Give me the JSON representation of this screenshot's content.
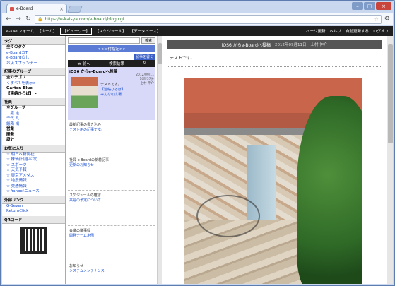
{
  "browser": {
    "tab_title": "e-Board",
    "url": "https://e-kaisya.com/e-board/blog.cgi"
  },
  "topnav": {
    "brand": "e-Kaelフォーム",
    "links": [
      "【ホーム】",
      "【ビューワー】",
      "【スケジュール】",
      "【データベース】"
    ],
    "right_links": [
      "ページ更新",
      "ヘルプ",
      "自動更新する",
      "ログオフ"
    ]
  },
  "sidebar": {
    "tags_title": "タグ",
    "all_tags": "全てのタグ",
    "tag_items": [
      "e-BoardカT",
      "e-Boardのし",
      "お店スプランナー"
    ],
    "group_title": "記事のグループ",
    "all_categories": "全カテゴリ",
    "group_items": [
      "くすべてを表示>",
      "Garten Blue -",
      "【連絡ひろば】 -"
    ],
    "company_title": "社員",
    "all_groups": "全グループ",
    "company_items": [
      "二瓶 進",
      "千代 凡",
      "総務 鳩",
      "営業",
      "開発",
      "設計"
    ],
    "fav_title": "お気に入り",
    "fav_items": [
      "☆ 朝日へ新聞社",
      "☆ 株価(日経平均)",
      "☆ スポーツ",
      "☆ 天気予報",
      "☆ 東京アメダス",
      "☆ 地震情報",
      "☆ 交通情報",
      "☆ Yahoo!ニュース"
    ],
    "ext_title": "外部リンク",
    "ext_items": [
      "G-Seven",
      "ReturnClick"
    ],
    "qr_title": "QRコード"
  },
  "middle": {
    "search_button": "検索",
    "date_bar": "<<日付指定>>",
    "new_post": "記事を書く",
    "prev": "≪ 前へ",
    "results": "検索結果",
    "selected_title": "iOS6 からe-Boardへ投稿",
    "selected_date": "2012/09/11",
    "selected_time": "10時57分",
    "selected_author": "上村 伸介",
    "selected_lines": [
      "テストです。",
      "【連絡ひろば】",
      "みんなの広場"
    ],
    "posts": [
      {
        "title": "最新記事の書き込み",
        "line2": "テスト用の記事です。"
      },
      {
        "title": "社員 e-Boardの新着記事",
        "line2": "更新のお知らせ"
      },
      {
        "title": "スケジュールの確認",
        "line2": "来週の予定について"
      },
      {
        "title": "会議の議事録",
        "line2": "開発チーム定例"
      },
      {
        "title": "お知らせ",
        "line2": "システムメンテナンス"
      }
    ]
  },
  "main": {
    "post_title": "iOS6 からe-Boardへ投稿",
    "post_date": "2012年09月11日",
    "post_author": "上村 伸介",
    "post_body": "テストです。"
  }
}
